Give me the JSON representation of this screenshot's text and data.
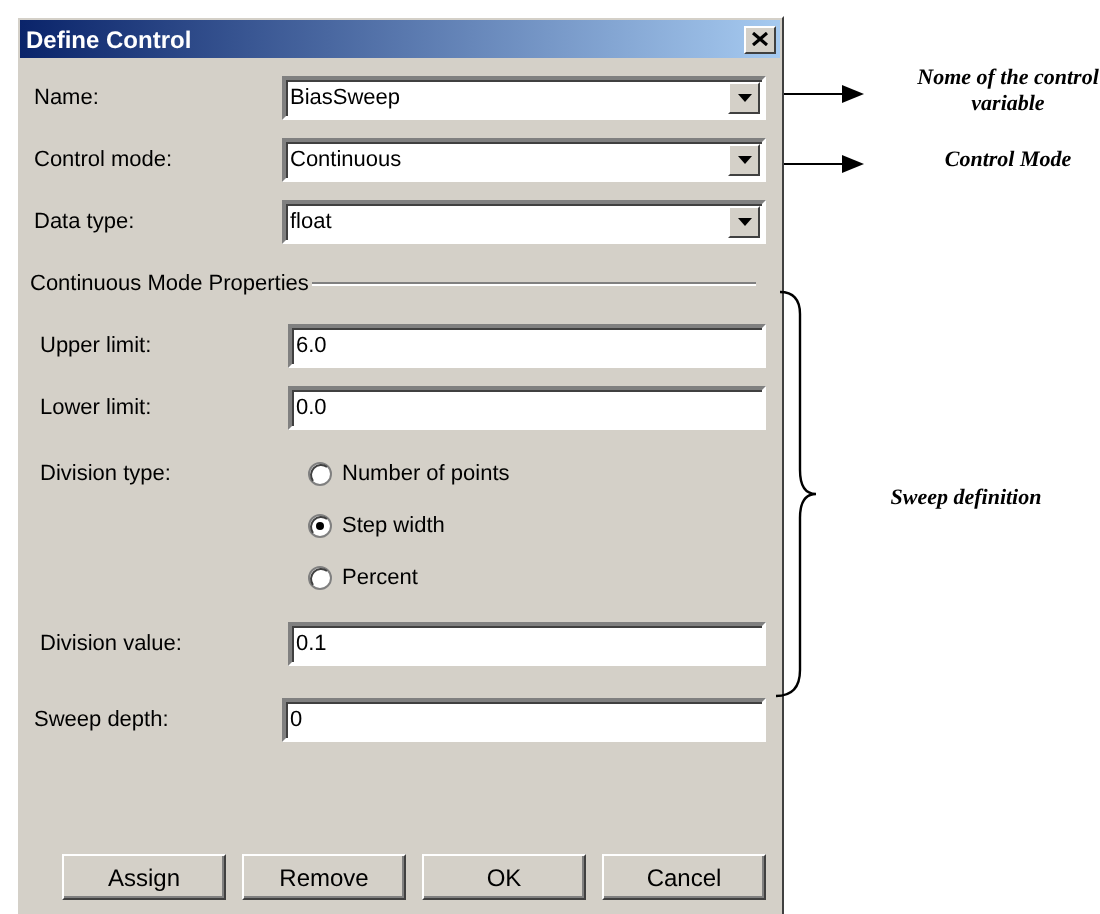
{
  "window": {
    "title": "Define Control"
  },
  "fields": [
    {
      "label": "Name:",
      "kind": "combo",
      "value": "BiasSweep"
    },
    {
      "label": "Control mode:",
      "kind": "combo",
      "value": "Continuous"
    },
    {
      "label": "Data type:",
      "kind": "combo",
      "value": "float"
    }
  ],
  "group": {
    "title": "Continuous Mode Properties",
    "rows": [
      {
        "label": "Upper limit:",
        "kind": "input",
        "value": "6.0"
      },
      {
        "label": "Lower limit:",
        "kind": "input",
        "value": "0.0"
      },
      {
        "label": "Division type:",
        "kind": "radio",
        "options": [
          {
            "label": "Number of points",
            "selected": false
          },
          {
            "label": "Step width",
            "selected": true
          },
          {
            "label": "Percent",
            "selected": false
          }
        ]
      },
      {
        "label": "Division value:",
        "kind": "input",
        "value": "0.1"
      }
    ]
  },
  "sweep_depth": {
    "label": "Sweep depth:",
    "value": "0"
  },
  "buttons": [
    "Assign",
    "Remove",
    "OK",
    "Cancel"
  ],
  "annotations": [
    {
      "kind": "arrow",
      "text": "Nome of the control variable"
    },
    {
      "kind": "arrow",
      "text": "Control Mode"
    },
    {
      "kind": "brace",
      "text": "Sweep definition"
    }
  ]
}
